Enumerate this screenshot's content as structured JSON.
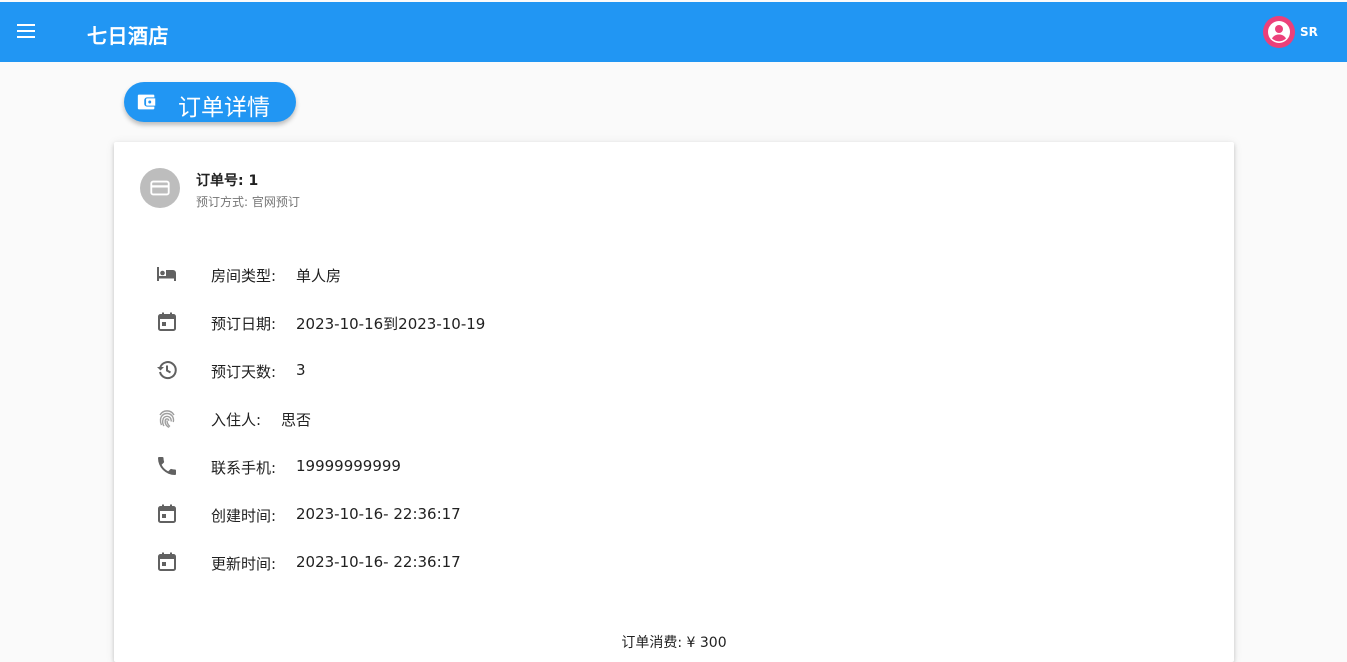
{
  "appbar": {
    "title": "七日酒店",
    "menu_icon": "menu-icon",
    "user": {
      "initials": "SR",
      "icon": "account-circle-icon",
      "color": "#ec407a"
    },
    "color": "#2196f3"
  },
  "page": {
    "chip_label": "订单详情",
    "chip_icon": "wallet-icon"
  },
  "order": {
    "number_label": "订单号: 1",
    "method_label": "预订方式:",
    "method_value": "官网预订",
    "icon": "credit-card-icon",
    "details": [
      {
        "icon": "bed-icon",
        "label": "房间类型:",
        "value": "单人房"
      },
      {
        "icon": "calendar-icon",
        "label": "预订日期:",
        "value": "2023-10-16到2023-10-19"
      },
      {
        "icon": "history-icon",
        "label": "预订天数:",
        "value": "3"
      },
      {
        "icon": "fingerprint-icon",
        "label": "入住人:",
        "value": "思否"
      },
      {
        "icon": "phone-icon",
        "label": "联系手机:",
        "value": "19999999999"
      },
      {
        "icon": "calendar-icon",
        "label": "创建时间:",
        "value": "2023-10-16- 22:36:17"
      },
      {
        "icon": "calendar-icon",
        "label": "更新时间:",
        "value": "2023-10-16- 22:36:17"
      }
    ],
    "total_label": "订单消费:",
    "total_value": "¥ 300"
  }
}
